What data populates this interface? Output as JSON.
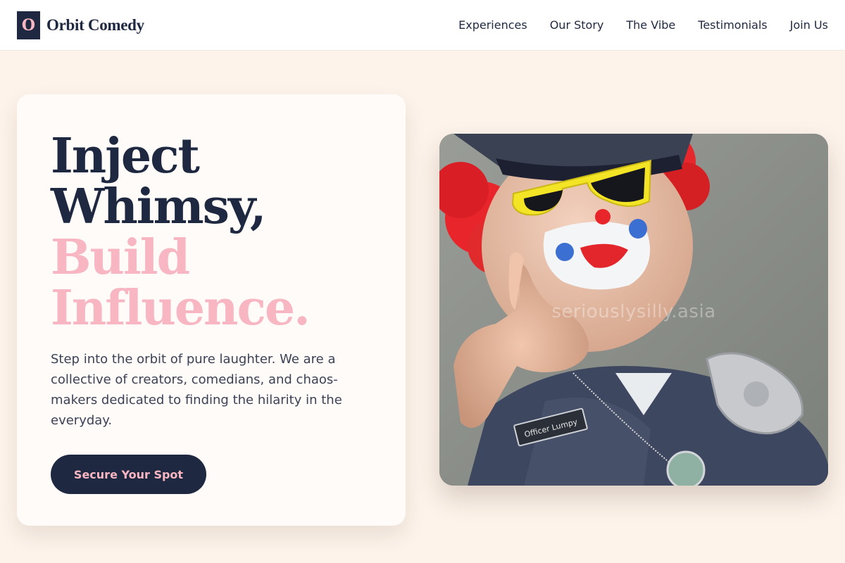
{
  "header": {
    "logo_letter": "O",
    "brand_name": "Orbit Comedy",
    "nav": [
      {
        "label": "Experiences"
      },
      {
        "label": "Our Story"
      },
      {
        "label": "The Vibe"
      },
      {
        "label": "Testimonials"
      },
      {
        "label": "Join Us"
      }
    ]
  },
  "hero": {
    "headline_line1": "Inject",
    "headline_line2": "Whimsy,",
    "headline_line3": "Build",
    "headline_line4": "Influence.",
    "description": "Step into the orbit of pure laughter. We are a collective of creators, comedians, and chaos-makers dedicated to finding the hilarity in the everyday.",
    "cta_label": "Secure Your Spot"
  },
  "photo": {
    "subject": "clown-police-officer",
    "watermark": "seriouslysilly.asia",
    "name_tag": "Officer Lumpy"
  },
  "colors": {
    "navy": "#1e2840",
    "pink": "#f7b6c2",
    "page_bg": "#fdf3ea",
    "card_bg": "#fffbf8"
  }
}
